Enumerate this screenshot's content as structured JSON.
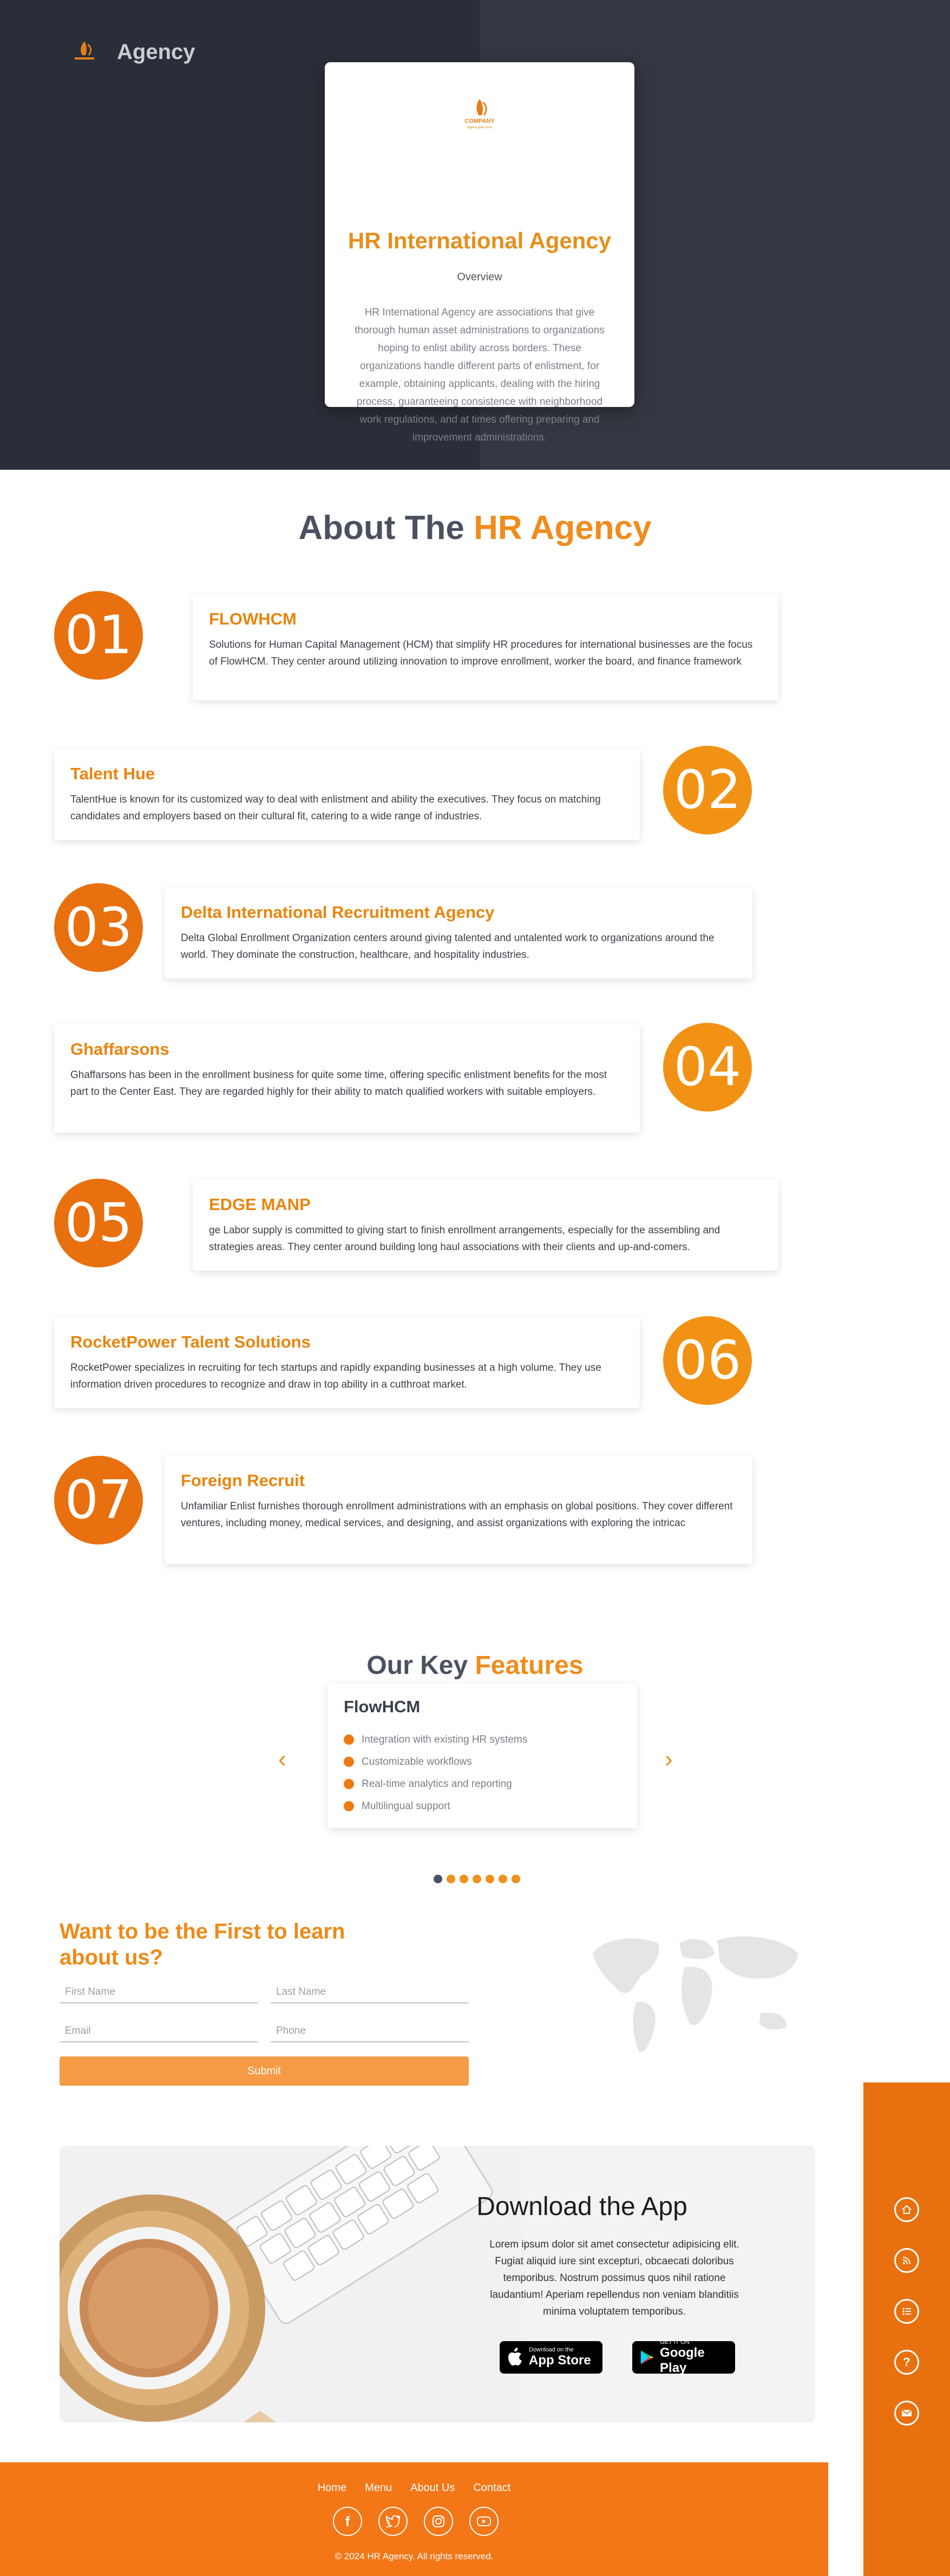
{
  "header": {
    "brand_name": "Agency"
  },
  "hero": {
    "logo_text": "COMPANY",
    "logo_tagline": "tagline goes here",
    "title": "HR International Agency",
    "subtitle": "Overview",
    "description": "HR International Agency are associations that give thorough human asset administrations to organizations hoping to enlist ability across borders. These organizations handle different parts of enlistment, for example, obtaining applicants, dealing with the hiring process, guaranteeing consistence with neighborhood work regulations, and at times offering preparing and improvement administrations."
  },
  "about": {
    "title_main": "About The",
    "title_accent": "HR Agency",
    "items": [
      {
        "number": "01",
        "title": "FLOWHCM",
        "text": "Solutions for Human Capital Management (HCM) that simplify HR procedures for international businesses are the focus of FlowHCM. They center around utilizing innovation to improve enrollment, worker the board, and finance framework"
      },
      {
        "number": "02",
        "title": "Talent Hue",
        "text": "TalentHue is known for its customized way to deal with enlistment and ability the executives. They focus on matching candidates and employers based on their cultural fit, catering to a wide range of industries."
      },
      {
        "number": "03",
        "title": "Delta International Recruitment Agency",
        "text": "Delta Global Enrollment Organization centers around giving talented and untalented work to organizations around the world. They dominate the construction, healthcare, and hospitality industries."
      },
      {
        "number": "04",
        "title": "Ghaffarsons",
        "text": "Ghaffarsons has been in the enrollment business for quite some time, offering specific enlistment benefits for the most part to the Center East. They are regarded highly for their ability to match qualified workers with suitable employers."
      },
      {
        "number": "05",
        "title": "EDGE MANP",
        "text": "ge Labor supply is committed to giving start to finish enrollment arrangements, especially for the assembling and strategies areas. They center around building long haul associations with their clients and up-and-comers."
      },
      {
        "number": "06",
        "title": "RocketPower Talent Solutions",
        "text": "RocketPower specializes in recruiting for tech startups and rapidly expanding businesses at a high volume. They use information driven procedures to recognize and draw in top ability in a cutthroat market."
      },
      {
        "number": "07",
        "title": "Foreign Recruit",
        "text": "Unfamiliar Enlist furnishes thorough enrollment administrations with an emphasis on global positions. They cover different ventures, including money, medical services, and designing, and assist organizations with exploring the intricac"
      }
    ]
  },
  "features": {
    "title_main": "Our Key",
    "title_accent": "Features",
    "card_title": "FlowHCM",
    "items": [
      "Integration with existing HR systems",
      "Customizable workflows",
      "Real-time analytics and reporting",
      "Multilingual support"
    ],
    "prev_icon": "chevron-left-icon",
    "next_icon": "chevron-right-icon"
  },
  "signup": {
    "title": "Want to be the First to learn about us?",
    "first_name_placeholder": "First Name",
    "last_name_placeholder": "Last Name",
    "email_placeholder": "Email",
    "phone_placeholder": "Phone",
    "submit_label": "Submit"
  },
  "app": {
    "title": "Download the App",
    "description": "Lorem ipsum dolor sit amet consectetur adipisicing elit. Fugiat aliquid iure sint excepturi, obcaecati doloribus temporibus. Nostrum possimus quos nihil ratione laudantium! Aperiam repellendus non veniam blanditiis minima voluptatem temporibus.",
    "appstore_small": "Download on the",
    "appstore_big": "App Store",
    "googleplay_small": "GET IT ON",
    "googleplay_big": "Google Play"
  },
  "side_panel": {
    "icons": [
      "home-icon",
      "rss-icon",
      "list-icon",
      "help-icon",
      "mail-icon"
    ]
  },
  "footer": {
    "links": [
      "Home",
      "Menu",
      "About Us",
      "Contact"
    ],
    "social_icons": [
      "facebook-icon",
      "twitter-icon",
      "instagram-icon",
      "youtube-icon"
    ],
    "copyright": "© 2024 HR Agency. All rights reserved."
  },
  "colors": {
    "accent": "#f08c1e",
    "dark_orange": "#e8700e",
    "hero_bg": "#2a2e38"
  }
}
